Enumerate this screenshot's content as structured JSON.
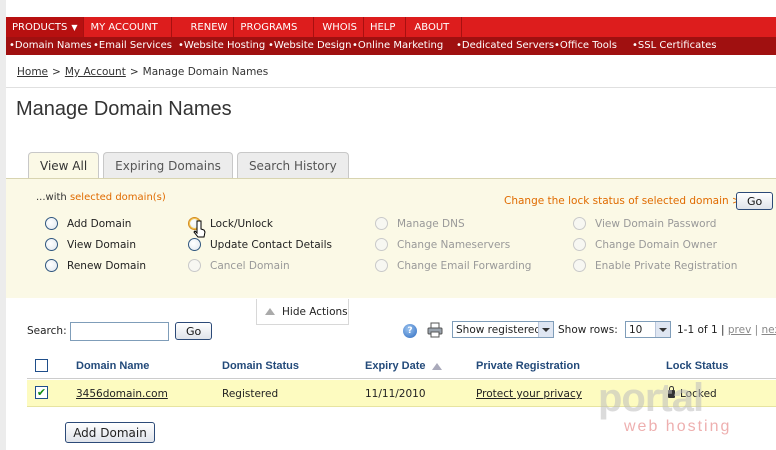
{
  "top_nav": [
    "PRODUCTS",
    "MY ACCOUNT",
    "RENEW",
    "PROGRAMS",
    "WHOIS",
    "HELP",
    "ABOUT"
  ],
  "sub_nav": [
    "•Domain Names",
    "•Email Services",
    "•Website Hosting",
    "•Website Design",
    "•Online Marketing",
    "•Dedicated Servers",
    "•Office Tools",
    "•SSL Certificates"
  ],
  "breadcrumb": {
    "home": "Home",
    "account": "My Account",
    "current": "Manage Domain Names",
    "sep": ">"
  },
  "page_title": "Manage Domain Names",
  "tabs": [
    "View All",
    "Expiring Domains",
    "Search History"
  ],
  "actions": {
    "with_prefix": "...with ",
    "with_selected": "selected domain(s)",
    "lock_link": "Change the lock status of selected domain >>",
    "go": "Go",
    "col1": [
      "Add Domain",
      "View Domain",
      "Renew Domain"
    ],
    "col2": [
      "Lock/Unlock",
      "Update Contact Details",
      "Cancel Domain"
    ],
    "col3": [
      "Manage DNS",
      "Change Nameservers",
      "Change Email Forwarding"
    ],
    "col4": [
      "View Domain Password",
      "Change Domain Owner",
      "Enable Private Registration"
    ],
    "hide": "Hide Actions"
  },
  "search": {
    "label": "Search:",
    "value": "",
    "go": "Go"
  },
  "toolbar": {
    "filter_value": "Show registered",
    "show_rows_label": "Show rows:",
    "rows_value": "10",
    "pagination": "1-1 of 1 |",
    "prev": "prev",
    "next_partial": "nex"
  },
  "table": {
    "headers": [
      "Domain Name",
      "Domain Status",
      "Expiry Date",
      "Private Registration",
      "Lock Status"
    ],
    "rows": [
      {
        "checked": true,
        "domain": "3456domain.com",
        "status": "Registered",
        "expiry": "11/11/2010",
        "privacy": "Protect your privacy",
        "lock": "Locked"
      }
    ]
  },
  "add_domain_button": "Add Domain",
  "watermark": {
    "big": "portal",
    "small": "web hosting"
  },
  "icons": [
    "help-icon",
    "printer-icon",
    "lock-icon",
    "mouse-cursor-icon"
  ],
  "colors": {
    "nav_red": "#dd1d1d",
    "subnav_red": "#a01010",
    "accent_orange": "#e06b00",
    "row_highlight": "#fdfbc0",
    "panel_bg": "#fbf9e6"
  }
}
